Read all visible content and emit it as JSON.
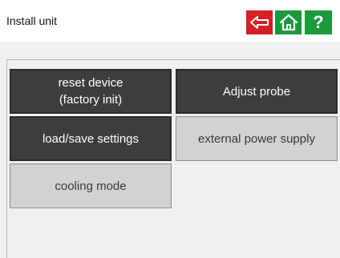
{
  "header": {
    "title": "Install unit",
    "back_icon": "back-arrow-icon",
    "home_icon": "home-icon",
    "help_icon": "help-icon",
    "help_glyph": "?",
    "colors": {
      "back": "#d61f26",
      "home": "#1a9a3a",
      "help": "#1a9a3a"
    }
  },
  "tiles": {
    "reset_line1": "reset device",
    "reset_line2": "(factory init)",
    "adjust_probe": "Adjust probe",
    "load_save": "load/save settings",
    "external_power": "external power supply",
    "cooling_mode": "cooling mode"
  },
  "colors": {
    "tile_dark": "#3d3d3d",
    "tile_light": "#d2d2d2",
    "panel": "#f0f0f0"
  }
}
